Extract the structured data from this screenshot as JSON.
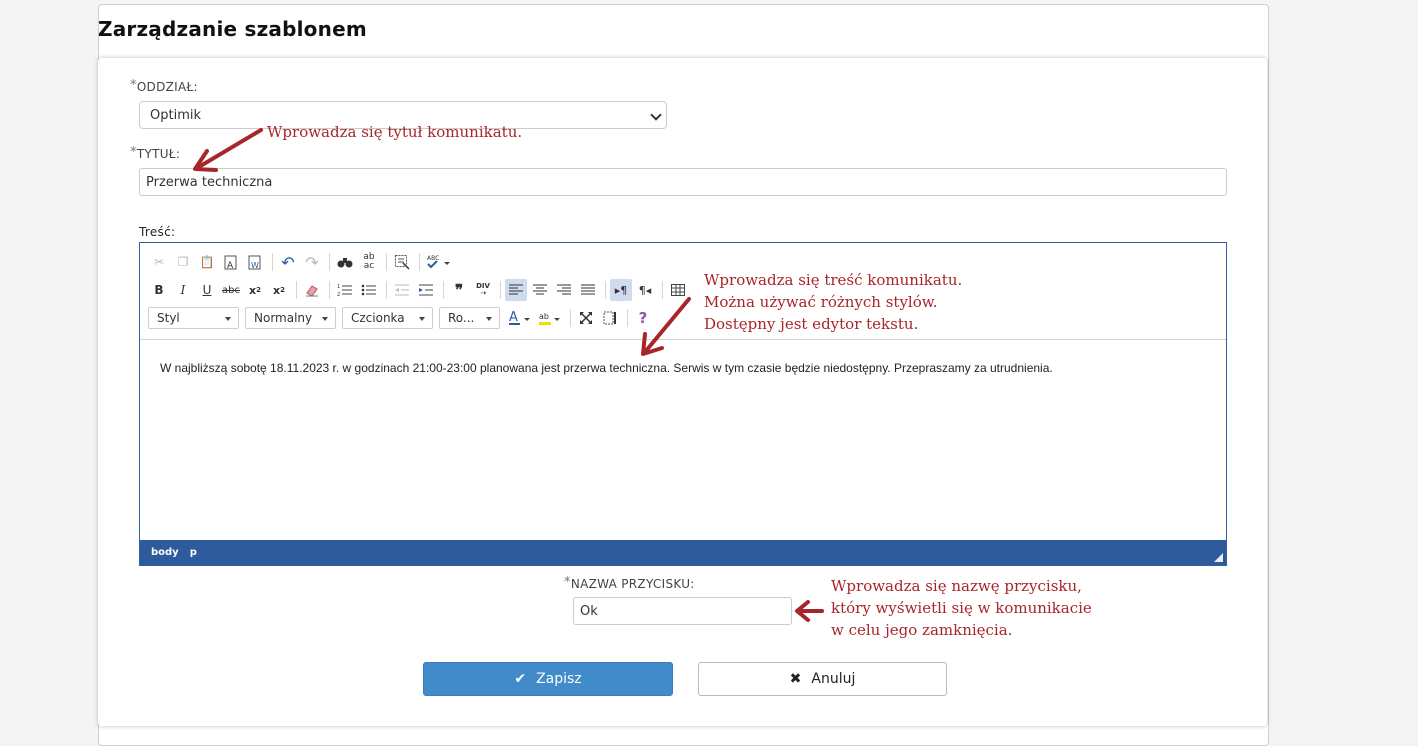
{
  "page": {
    "title": "Zarządzanie szablonem"
  },
  "form": {
    "required_mark": "*",
    "branch": {
      "label": "ODDZIAŁ:",
      "value": "Optimik"
    },
    "title_field": {
      "label": "TYTUŁ:",
      "value": "Przerwa techniczna"
    },
    "content_label": "Treść:",
    "button_name": {
      "label": "NAZWA PRZYCISKU:",
      "value": "Ok"
    }
  },
  "editor": {
    "combos": {
      "style": "Styl",
      "format": "Normalny",
      "font": "Czcionka",
      "size": "Ro..."
    },
    "body_text": "W najbliższą sobotę 18.11.2023 r. w godzinach 21:00-23:00 planowana jest przerwa techniczna. Serwis w tym czasie będzie niedostępny. Przepraszamy za utrudnienia.",
    "status_path": [
      "body",
      "p"
    ]
  },
  "annotations": {
    "title": "Wprowadza się tytuł komunikatu.",
    "content": [
      "Wprowadza się treść komunikatu.",
      "Można używać różnych stylów.",
      "Dostępny jest edytor tekstu."
    ],
    "button": [
      "Wprowadza się nazwę przycisku,",
      "który wyświetli się w komunikacie",
      "w celu jego zamknięcia."
    ]
  },
  "actions": {
    "save": "Zapisz",
    "cancel": "Anuluj"
  },
  "colors": {
    "annotation": "#a8252b",
    "primary_button": "#428bca",
    "editor_status_bar": "#2d5b9b"
  },
  "icons": {
    "toolbar_row1": [
      "cut-icon",
      "copy-icon",
      "paste-icon",
      "paste-text-icon",
      "paste-word-icon",
      "undo-icon",
      "redo-icon",
      "find-icon",
      "replace-icon",
      "select-all-icon",
      "spellcheck-icon"
    ],
    "toolbar_row2": [
      "bold-icon",
      "italic-icon",
      "underline-icon",
      "strikethrough-icon",
      "subscript-icon",
      "superscript-icon",
      "remove-format-icon",
      "numbered-list-icon",
      "bulleted-list-icon",
      "outdent-icon",
      "indent-icon",
      "blockquote-icon",
      "div-icon",
      "align-left-icon",
      "align-center-icon",
      "align-right-icon",
      "justify-icon",
      "ltr-icon",
      "rtl-icon",
      "table-icon"
    ],
    "toolbar_row3": [
      "text-color-icon",
      "background-color-icon",
      "maximize-icon",
      "show-blocks-icon",
      "help-icon"
    ],
    "save": "check-icon",
    "cancel": "close-icon"
  }
}
